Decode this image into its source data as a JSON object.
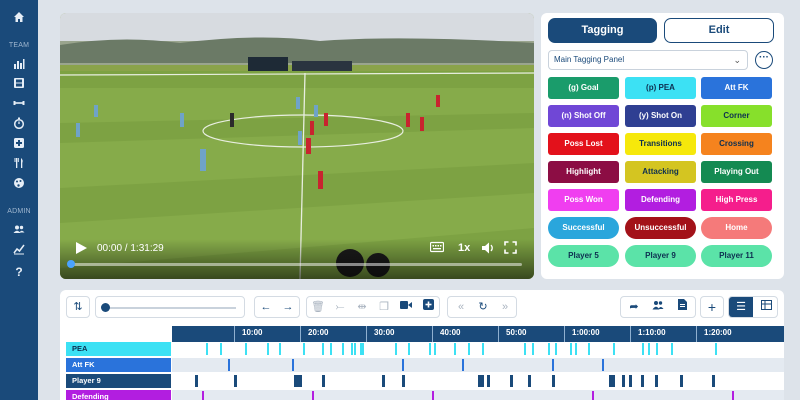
{
  "sidebar": {
    "sections": [
      {
        "label": "TEAM"
      },
      {
        "label": "ADMIN"
      }
    ],
    "icons": [
      "home-icon",
      "bar-chart-icon",
      "film-icon",
      "dumbbell-icon",
      "stopwatch-icon",
      "medical-icon",
      "cutlery-icon",
      "palette-icon",
      "users-icon",
      "line-chart-icon",
      "help-icon"
    ]
  },
  "video": {
    "time_display": "00:00 / 1:31:29",
    "speed": "1x",
    "progress_fraction": 0.0
  },
  "tagging_panel": {
    "tabs": [
      "Tagging",
      "Edit"
    ],
    "active_tab": "Tagging",
    "selected_panel": "Main Tagging Panel",
    "buttons": [
      {
        "label": "(g) Goal",
        "color": "#1a9c6b",
        "text": "#ffffff",
        "shape": "rect"
      },
      {
        "label": "(p) PEA",
        "color": "#3ce1f4",
        "text": "#0d2f50",
        "shape": "rect"
      },
      {
        "label": "Att FK",
        "color": "#2a73db",
        "text": "#ffffff",
        "shape": "rect"
      },
      {
        "label": "(n) Shot Off",
        "color": "#7047d6",
        "text": "#ffffff",
        "shape": "rect"
      },
      {
        "label": "(y) Shot On",
        "color": "#2f3f92",
        "text": "#ffffff",
        "shape": "rect"
      },
      {
        "label": "Corner",
        "color": "#87e02b",
        "text": "#0d2f50",
        "shape": "rect"
      },
      {
        "label": "Poss Lost",
        "color": "#e3111b",
        "text": "#ffffff",
        "shape": "rect"
      },
      {
        "label": "Transitions",
        "color": "#f6e80b",
        "text": "#0d2f50",
        "shape": "rect"
      },
      {
        "label": "Crossing",
        "color": "#f5831e",
        "text": "#0d2f50",
        "shape": "rect"
      },
      {
        "label": "Highlight",
        "color": "#8c0d44",
        "text": "#ffffff",
        "shape": "rect"
      },
      {
        "label": "Attacking",
        "color": "#d4c521",
        "text": "#0d2f50",
        "shape": "rect"
      },
      {
        "label": "Playing Out",
        "color": "#148a52",
        "text": "#ffffff",
        "shape": "rect"
      },
      {
        "label": "Poss Won",
        "color": "#f03ef0",
        "text": "#ffffff",
        "shape": "rect"
      },
      {
        "label": "Defending",
        "color": "#b21ee0",
        "text": "#ffffff",
        "shape": "rect"
      },
      {
        "label": "High Press",
        "color": "#f51e8c",
        "text": "#ffffff",
        "shape": "rect"
      },
      {
        "label": "Successful",
        "color": "#2aa6dc",
        "text": "#ffffff",
        "shape": "pill"
      },
      {
        "label": "Unsuccessful",
        "color": "#a31219",
        "text": "#ffffff",
        "shape": "pill"
      },
      {
        "label": "Home",
        "color": "#f57a7a",
        "text": "#ffffff",
        "shape": "pill"
      },
      {
        "label": "Player 5",
        "color": "#5be3a8",
        "text": "#0d2f50",
        "shape": "pill"
      },
      {
        "label": "Player 9",
        "color": "#5be3a8",
        "text": "#0d2f50",
        "shape": "pill"
      },
      {
        "label": "Player 11",
        "color": "#5be3a8",
        "text": "#0d2f50",
        "shape": "pill"
      }
    ]
  },
  "timeline": {
    "ticks": [
      "10:00",
      "20:00",
      "30:00",
      "40:00",
      "50:00",
      "1:00:00",
      "1:10:00",
      "1:20:00"
    ],
    "rows": [
      {
        "label": "PEA",
        "color": "#3ce1f4",
        "text": "#0d2f50",
        "track": "#ffffff"
      },
      {
        "label": "Att FK",
        "color": "#2a73db",
        "text": "#ffffff",
        "track": "#e4eaf1"
      },
      {
        "label": "Player 9",
        "color": "#1a4a7a",
        "text": "#ffffff",
        "track": "#ffffff"
      },
      {
        "label": "Defending",
        "color": "#b21ee0",
        "text": "#ffffff",
        "track": "#e4eaf1"
      }
    ]
  }
}
